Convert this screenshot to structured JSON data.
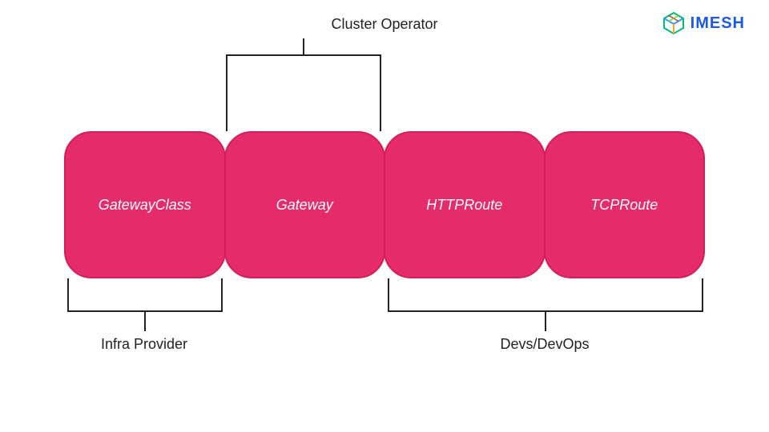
{
  "logo": {
    "text": "IMESH"
  },
  "labels": {
    "top": "Cluster Operator",
    "bottom_left": "Infra Provider",
    "bottom_right": "Devs/DevOps"
  },
  "boxes": [
    {
      "label": "GatewayClass"
    },
    {
      "label": "Gateway"
    },
    {
      "label": "HTTPRoute"
    },
    {
      "label": "TCPRoute"
    }
  ],
  "colors": {
    "box_fill": "#e52b6b",
    "box_border": "#d11f5d",
    "logo_text": "#1b5ae6"
  }
}
